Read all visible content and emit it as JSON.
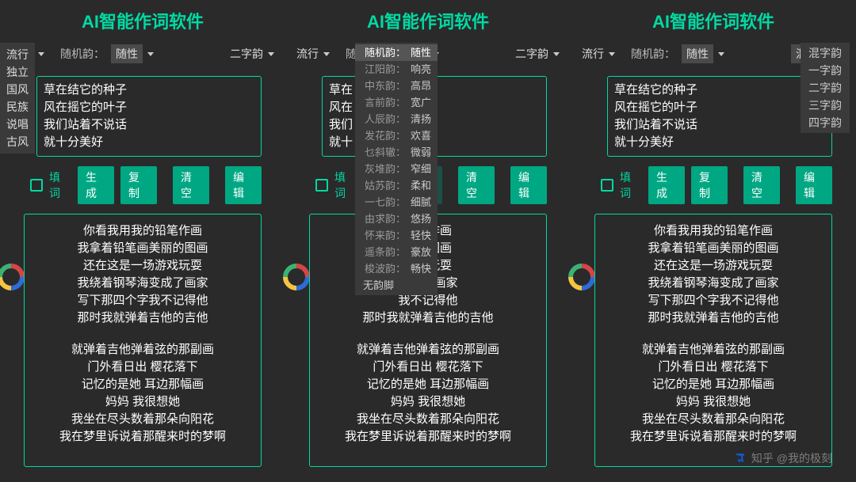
{
  "title": "AI智能作词软件",
  "genre_selected": "流行",
  "rhyme_label": "随机韵：",
  "rhyme_selected": "随性",
  "type_selected": "二字韵",
  "genres": [
    "流行",
    "独立",
    "国风",
    "民族",
    "说唱",
    "古风"
  ],
  "rhyme_options": [
    {
      "k": "随机韵：",
      "v": "随性"
    },
    {
      "k": "江阳韵：",
      "v": "响亮"
    },
    {
      "k": "中东韵：",
      "v": "高昂"
    },
    {
      "k": "言前韵：",
      "v": "宽广"
    },
    {
      "k": "人辰韵：",
      "v": "清扬"
    },
    {
      "k": "发花韵：",
      "v": "欢喜"
    },
    {
      "k": "乜斜辙：",
      "v": "微弱"
    },
    {
      "k": "灰堆韵：",
      "v": "窄细"
    },
    {
      "k": "姑苏韵：",
      "v": "柔和"
    },
    {
      "k": "一七韵：",
      "v": "细腻"
    },
    {
      "k": "由求韵：",
      "v": "悠扬"
    },
    {
      "k": "怀来韵：",
      "v": "轻快"
    },
    {
      "k": "遥条韵：",
      "v": "豪放"
    },
    {
      "k": "梭波韵：",
      "v": "畅快"
    }
  ],
  "rhyme_no": "无韵脚",
  "type_options": [
    "混字韵",
    "一字韵",
    "二字韵",
    "三字韵",
    "四字韵"
  ],
  "input_lines": [
    "草在结它的种子",
    "风在摇它的叶子",
    "我们站着不说话",
    "就十分美好"
  ],
  "input_partial": [
    "草在",
    "风在",
    "我们",
    "就十"
  ],
  "chk_label": "填词",
  "buttons": {
    "gen": "生成",
    "copy": "复制",
    "clear": "清空",
    "edit": "编辑"
  },
  "output": {
    "s1": [
      "你看我用我的铅笔作画",
      "我拿着铅笔画美丽的图画",
      "还在这是一场游戏玩耍",
      "我绕着钢琴海变成了画家",
      "写下那四个字我不记得他",
      "那时我就弹着吉他的吉他"
    ],
    "s1b": [
      "",
      "",
      "铅笔作画",
      "丽的图画",
      "游戏玩耍",
      "戈成了画家",
      "我不记得他",
      "那时我就弹着吉他的吉他"
    ],
    "s2": [
      "就弹着吉他弹着弦的那副画",
      "门外看日出  樱花落下",
      "记忆的是她 耳边那幅画",
      "妈妈 我很想她",
      "我坐在尽头数着那朵向阳花",
      "我在梦里诉说着那醒来时的梦啊"
    ]
  },
  "watermark": "知乎 @我的极刻"
}
